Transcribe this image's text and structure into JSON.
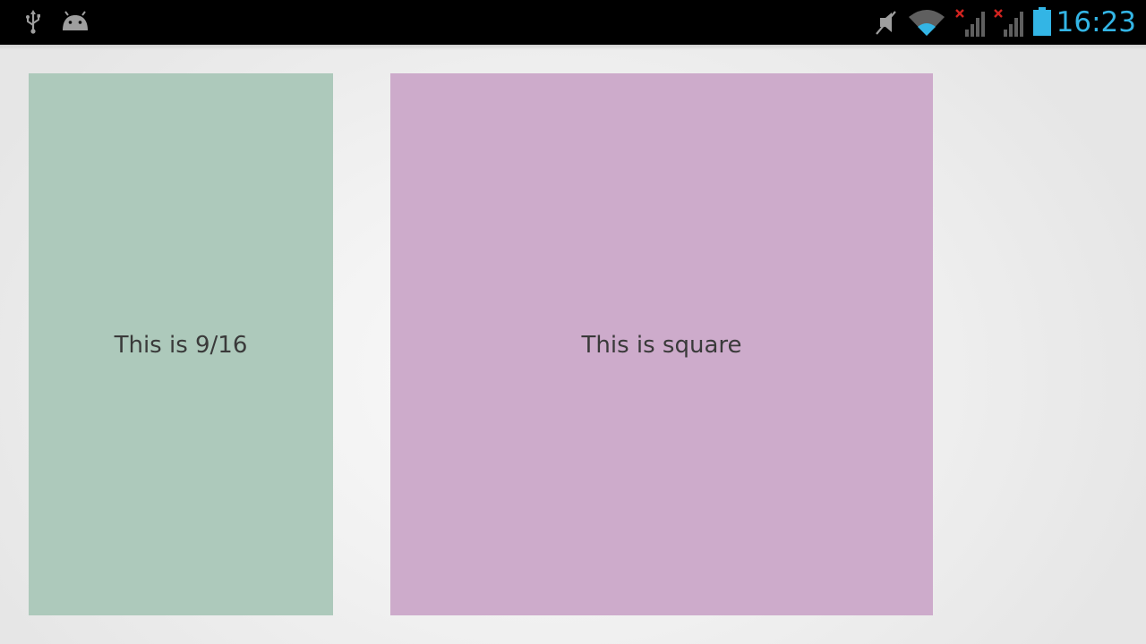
{
  "status_bar": {
    "left_icons": [
      "usb-icon",
      "android-debug-icon"
    ],
    "right_icons": [
      "mute-icon",
      "wifi-icon",
      "signal-no-service-icon",
      "signal-no-service-icon",
      "battery-icon"
    ],
    "time": "16:23",
    "time_color": "#33b5e5",
    "icon_color": "#9e9e9e",
    "error_color": "#d0231f",
    "battery_color": "#33b5e5"
  },
  "panels": [
    {
      "label": "This is 9/16",
      "color": "#adc9bb"
    },
    {
      "label": "This is square",
      "color": "#cdabcb"
    }
  ]
}
